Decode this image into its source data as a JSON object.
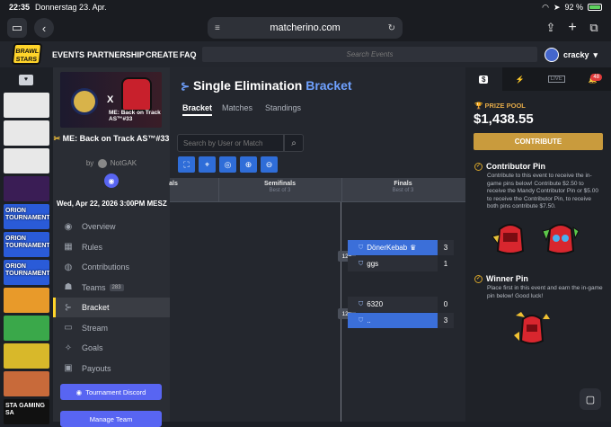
{
  "status": {
    "time": "22:35",
    "date": "Donnerstag 23. Apr.",
    "battery": "92 %"
  },
  "browser": {
    "url": "matcherino.com"
  },
  "nav": {
    "logo_line1": "BRAWL",
    "logo_line2": "STARS",
    "events": "EVENTS",
    "partnership": "PARTNERSHIP",
    "create": "CREATE",
    "faq": "FAQ",
    "search_placeholder": "Search Events",
    "username": "cracky"
  },
  "left_thumbs": [
    "",
    "",
    "",
    "",
    "ORION TOURNAMENT",
    "ORION TOURNAMENT",
    "ORION TOURNAMENT",
    "",
    "",
    "",
    "",
    "STA GAMING SA"
  ],
  "sidebar": {
    "banner_x": "X",
    "banner_text": "ME: Back on Track AS™#33",
    "event_title": "ME: Back on Track AS™#33",
    "by": "by",
    "organizer": "NotGAK",
    "datetime": "Wed, Apr 22, 2026 3:00PM MESZ",
    "menu": [
      {
        "label": "Overview",
        "icon": "overview-icon"
      },
      {
        "label": "Rules",
        "icon": "rules-icon"
      },
      {
        "label": "Contributions",
        "icon": "contributions-icon"
      },
      {
        "label": "Teams",
        "icon": "teams-icon",
        "badge": "283"
      },
      {
        "label": "Bracket",
        "icon": "bracket-icon"
      },
      {
        "label": "Stream",
        "icon": "stream-icon"
      },
      {
        "label": "Goals",
        "icon": "goals-icon"
      },
      {
        "label": "Payouts",
        "icon": "payouts-icon"
      }
    ],
    "discord_button": "Tournament Discord",
    "manage_button": "Manage Team"
  },
  "main": {
    "title_a": "Single Elimination",
    "title_b": "Bracket",
    "tabs": [
      "Bracket",
      "Matches",
      "Standings"
    ],
    "search_placeholder": "Search by User or Match",
    "rounds": [
      {
        "name": "als",
        "sub": ""
      },
      {
        "name": "Semifinals",
        "sub": "Best of 3"
      },
      {
        "name": "Finals",
        "sub": "Best of 3"
      }
    ],
    "matches": [
      {
        "num": "125",
        "teams": [
          {
            "name": "DönerKebab",
            "crown": "♛",
            "score": "3",
            "win": true
          },
          {
            "name": "ggs",
            "score": "1",
            "win": false
          }
        ]
      },
      {
        "num": "126",
        "teams": [
          {
            "name": "6320",
            "score": "0",
            "win": false
          },
          {
            "name": "..",
            "score": "3",
            "win": true
          }
        ]
      }
    ]
  },
  "right": {
    "tabs": [
      "$",
      "⚡",
      "LIVE",
      "🔔"
    ],
    "notif_count": "48",
    "prize_label": "PRIZE POOL",
    "prize_value": "$1,438.55",
    "contribute": "CONTRIBUTE",
    "contrib_pin_title": "Contributor Pin",
    "contrib_pin_desc": "Contribute to this event to receive the in-game pins below! Contribute $2.50 to receive the Mandy Contributor Pin or $5.00 to receive the Contributor Pin, to receive both pins contribute $7.50.",
    "winner_pin_title": "Winner Pin",
    "winner_pin_desc": "Place first in this event and earn the in-game pin below! Good luck!"
  },
  "colors": {
    "accent_blue": "#3b6fd9",
    "gold": "#c99b3d",
    "discord": "#5865f2"
  }
}
